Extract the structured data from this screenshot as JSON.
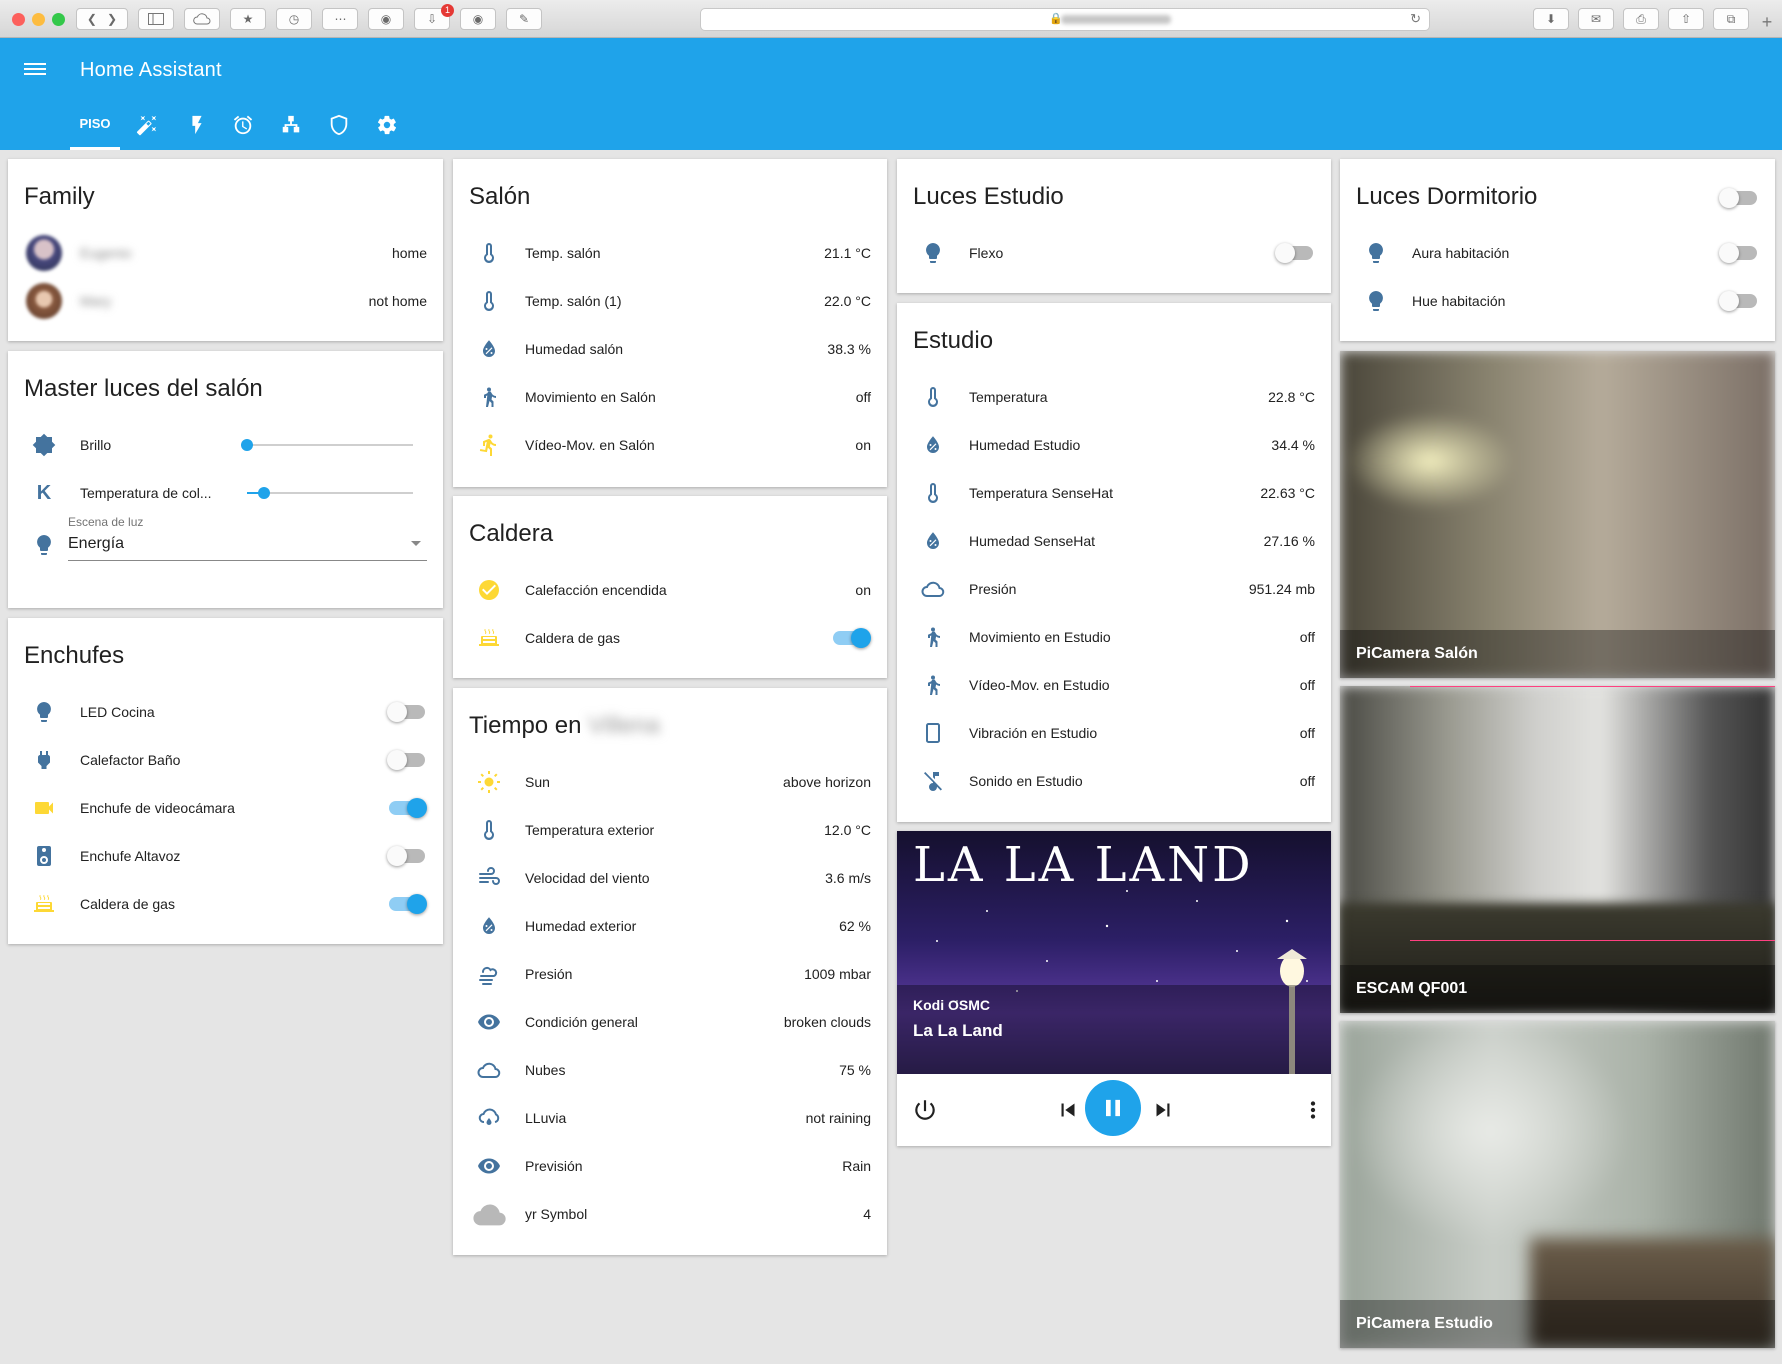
{
  "app": {
    "title": "Home Assistant"
  },
  "browser": {
    "notification_count": "1"
  },
  "tabs": [
    {
      "label": "PISO",
      "icon": "home-tab",
      "active": true
    },
    {
      "label": "",
      "icon": "magic-wand-icon"
    },
    {
      "label": "",
      "icon": "flash-icon"
    },
    {
      "label": "",
      "icon": "alarm-clock-icon"
    },
    {
      "label": "",
      "icon": "sitemap-icon"
    },
    {
      "label": "",
      "icon": "shield-icon"
    },
    {
      "label": "",
      "icon": "gear-icon"
    }
  ],
  "family": {
    "title": "Family",
    "members": [
      {
        "name": "Eugenio",
        "state": "home"
      },
      {
        "name": "Mary",
        "state": "not home"
      }
    ]
  },
  "master_luces": {
    "title": "Master luces del salón",
    "brillo": {
      "label": "Brillo",
      "level": 0.0
    },
    "temperatura": {
      "label": "Temperatura de col...",
      "level": 0.1
    },
    "escena": {
      "label": "Escena de luz",
      "value": "Energía"
    }
  },
  "enchufes": {
    "title": "Enchufes",
    "items": [
      {
        "label": "LED Cocina",
        "icon": "lightbulb-icon",
        "on": false
      },
      {
        "label": "Calefactor Baño",
        "icon": "power-plug-icon",
        "on": false
      },
      {
        "label": "Enchufe de videocámara",
        "icon": "video-camera-icon",
        "on": true
      },
      {
        "label": "Enchufe Altavoz",
        "icon": "speaker-icon",
        "on": false
      },
      {
        "label": "Caldera de gas",
        "icon": "radiator-icon",
        "on": true
      }
    ]
  },
  "salon": {
    "title": "Salón",
    "items": [
      {
        "label": "Temp. salón",
        "value": "21.1 °C",
        "icon": "thermometer-icon"
      },
      {
        "label": "Temp. salón (1)",
        "value": "22.0 °C",
        "icon": "thermometer-icon"
      },
      {
        "label": "Humedad salón",
        "value": "38.3 %",
        "icon": "water-percent-icon"
      },
      {
        "label": "Movimiento en Salón",
        "value": "off",
        "icon": "walk-icon"
      },
      {
        "label": "Vídeo-Mov. en Salón",
        "value": "on",
        "icon": "run-icon"
      }
    ]
  },
  "caldera": {
    "title": "Caldera",
    "calefaccion": {
      "label": "Calefacción encendida",
      "value": "on"
    },
    "gas": {
      "label": "Caldera de gas",
      "on": true
    }
  },
  "tiempo": {
    "title": "Tiempo en",
    "location": "Villena",
    "items": [
      {
        "label": "Sun",
        "value": "above horizon",
        "icon": "sun-icon"
      },
      {
        "label": "Temperatura exterior",
        "value": "12.0 °C",
        "icon": "thermometer-icon"
      },
      {
        "label": "Velocidad del viento",
        "value": "3.6 m/s",
        "icon": "wind-icon"
      },
      {
        "label": "Humedad exterior",
        "value": "62 %",
        "icon": "water-percent-icon"
      },
      {
        "label": "Presión",
        "value": "1009 mbar",
        "icon": "cloud-wind-icon"
      },
      {
        "label": "Condición general",
        "value": "broken clouds",
        "icon": "eye-icon"
      },
      {
        "label": "Nubes",
        "value": "75 %",
        "icon": "cloud-outline-icon"
      },
      {
        "label": "LLuvia",
        "value": "not raining",
        "icon": "cloud-rain-icon"
      },
      {
        "label": "Previsión",
        "value": "Rain",
        "icon": "eye-icon"
      },
      {
        "label": "yr Symbol",
        "value": "4",
        "icon": "cloud-picture-icon"
      }
    ]
  },
  "luces_estudio": {
    "title": "Luces Estudio",
    "items": [
      {
        "label": "Flexo",
        "on": false
      }
    ]
  },
  "estudio": {
    "title": "Estudio",
    "items": [
      {
        "label": "Temperatura",
        "value": "22.8 °C",
        "icon": "thermometer-icon"
      },
      {
        "label": "Humedad Estudio",
        "value": "34.4 %",
        "icon": "water-percent-icon"
      },
      {
        "label": "Temperatura SenseHat",
        "value": "22.63 °C",
        "icon": "thermometer-icon"
      },
      {
        "label": "Humedad SenseHat",
        "value": "27.16 %",
        "icon": "water-percent-icon"
      },
      {
        "label": "Presión",
        "value": "951.24 mb",
        "icon": "cloud-outline-icon"
      },
      {
        "label": "Movimiento en Estudio",
        "value": "off",
        "icon": "walk-icon"
      },
      {
        "label": "Vídeo-Mov. en Estudio",
        "value": "off",
        "icon": "walk-icon"
      },
      {
        "label": "Vibración en Estudio",
        "value": "off",
        "icon": "tablet-icon"
      },
      {
        "label": "Sonido en Estudio",
        "value": "off",
        "icon": "music-off-icon"
      }
    ]
  },
  "media": {
    "poster_title": "LA LA LAND",
    "player": "Kodi OSMC",
    "now_playing": "La La Land"
  },
  "luces_dormitorio": {
    "title": "Luces Dormitorio",
    "master_on": false,
    "items": [
      {
        "label": "Aura habitación",
        "on": false
      },
      {
        "label": "Hue habitación",
        "on": false
      }
    ]
  },
  "cameras": [
    {
      "caption": "PiCamera Salón"
    },
    {
      "caption": "ESCAM QF001"
    },
    {
      "caption": "PiCamera Estudio"
    }
  ],
  "colors": {
    "primary": "#1fa3ea",
    "icon_blue": "#44739e",
    "icon_yellow": "#fdd835",
    "accent_pink": "#ff4081"
  }
}
